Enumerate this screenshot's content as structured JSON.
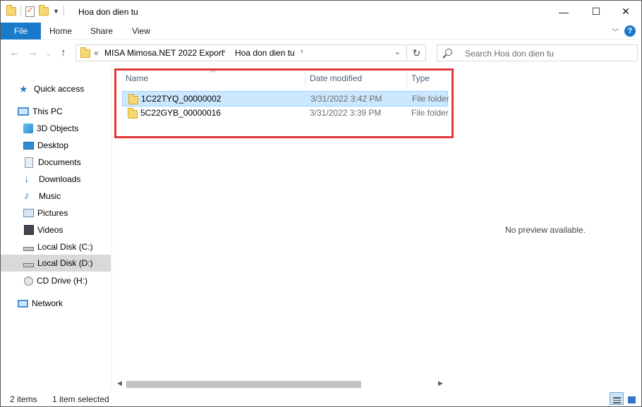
{
  "window": {
    "title": "Hoa don dien tu",
    "controls": {
      "minimize": "—",
      "maximize": "☐",
      "close": "✕"
    }
  },
  "ribbon": {
    "tabs": [
      "File",
      "Home",
      "Share",
      "View"
    ],
    "help": "?"
  },
  "address": {
    "overflow": "«",
    "crumbs": [
      "MISA Mimosa.NET 2022 Export",
      "Hoa don dien tu"
    ]
  },
  "search": {
    "placeholder": "Search Hoa don dien tu"
  },
  "sidebar": {
    "items": [
      {
        "label": "Quick access",
        "icon": "star-icon"
      },
      {
        "label": "This PC",
        "icon": "computer-icon"
      },
      {
        "label": "3D Objects",
        "icon": "3d-objects-icon"
      },
      {
        "label": "Desktop",
        "icon": "desktop-icon"
      },
      {
        "label": "Documents",
        "icon": "documents-icon"
      },
      {
        "label": "Downloads",
        "icon": "downloads-icon"
      },
      {
        "label": "Music",
        "icon": "music-icon"
      },
      {
        "label": "Pictures",
        "icon": "pictures-icon"
      },
      {
        "label": "Videos",
        "icon": "videos-icon"
      },
      {
        "label": "Local Disk (C:)",
        "icon": "drive-icon"
      },
      {
        "label": "Local Disk (D:)",
        "icon": "drive-icon",
        "selected": true
      },
      {
        "label": "CD Drive (H:)",
        "icon": "cd-drive-icon"
      },
      {
        "label": "Network",
        "icon": "network-icon"
      }
    ]
  },
  "content": {
    "columns": [
      "Name",
      "Date modified",
      "Type"
    ],
    "rows": [
      {
        "name": "1C22TYQ_00000002",
        "date": "3/31/2022 3:42 PM",
        "type": "File folder",
        "selected": true
      },
      {
        "name": "5C22GYB_00000016",
        "date": "3/31/2022 3:39 PM",
        "type": "File folder",
        "selected": false
      }
    ]
  },
  "preview": {
    "text": "No preview available."
  },
  "status": {
    "items": "2 items",
    "selected": "1 item selected"
  },
  "colors": {
    "accent": "#1979ca",
    "highlight_box": "#e23838",
    "selection": "#cce8ff"
  }
}
